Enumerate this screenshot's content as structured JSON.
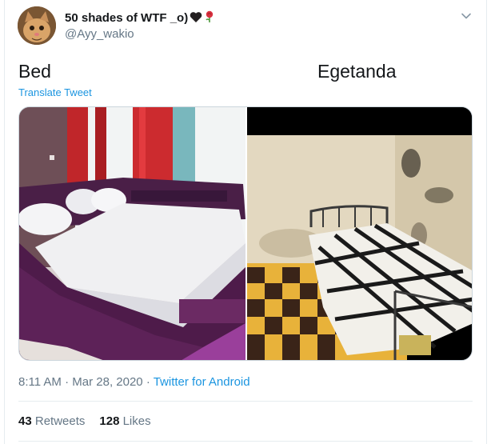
{
  "tweet": {
    "user": {
      "display_name": "50 shades of WTF _o)",
      "handle": "@Ayy_wakio",
      "name_emojis": [
        "black-heart",
        "rose"
      ]
    },
    "text_left": "Bed",
    "text_right": "Egetanda",
    "translate_label": "Translate Tweet",
    "media": {
      "left_image": "purple-bed-in-bright-room",
      "right_image": "old-metal-bed-checkered-floor-moldy-wall"
    },
    "time": "8:11 AM",
    "date": "Mar 28, 2020",
    "source": "Twitter for Android",
    "retweets_count": "43",
    "retweets_label": "Retweets",
    "likes_count": "128",
    "likes_label": "Likes"
  },
  "colors": {
    "link": "#1b95e0",
    "secondary_text": "#657786",
    "divider": "#e6ecf0"
  }
}
